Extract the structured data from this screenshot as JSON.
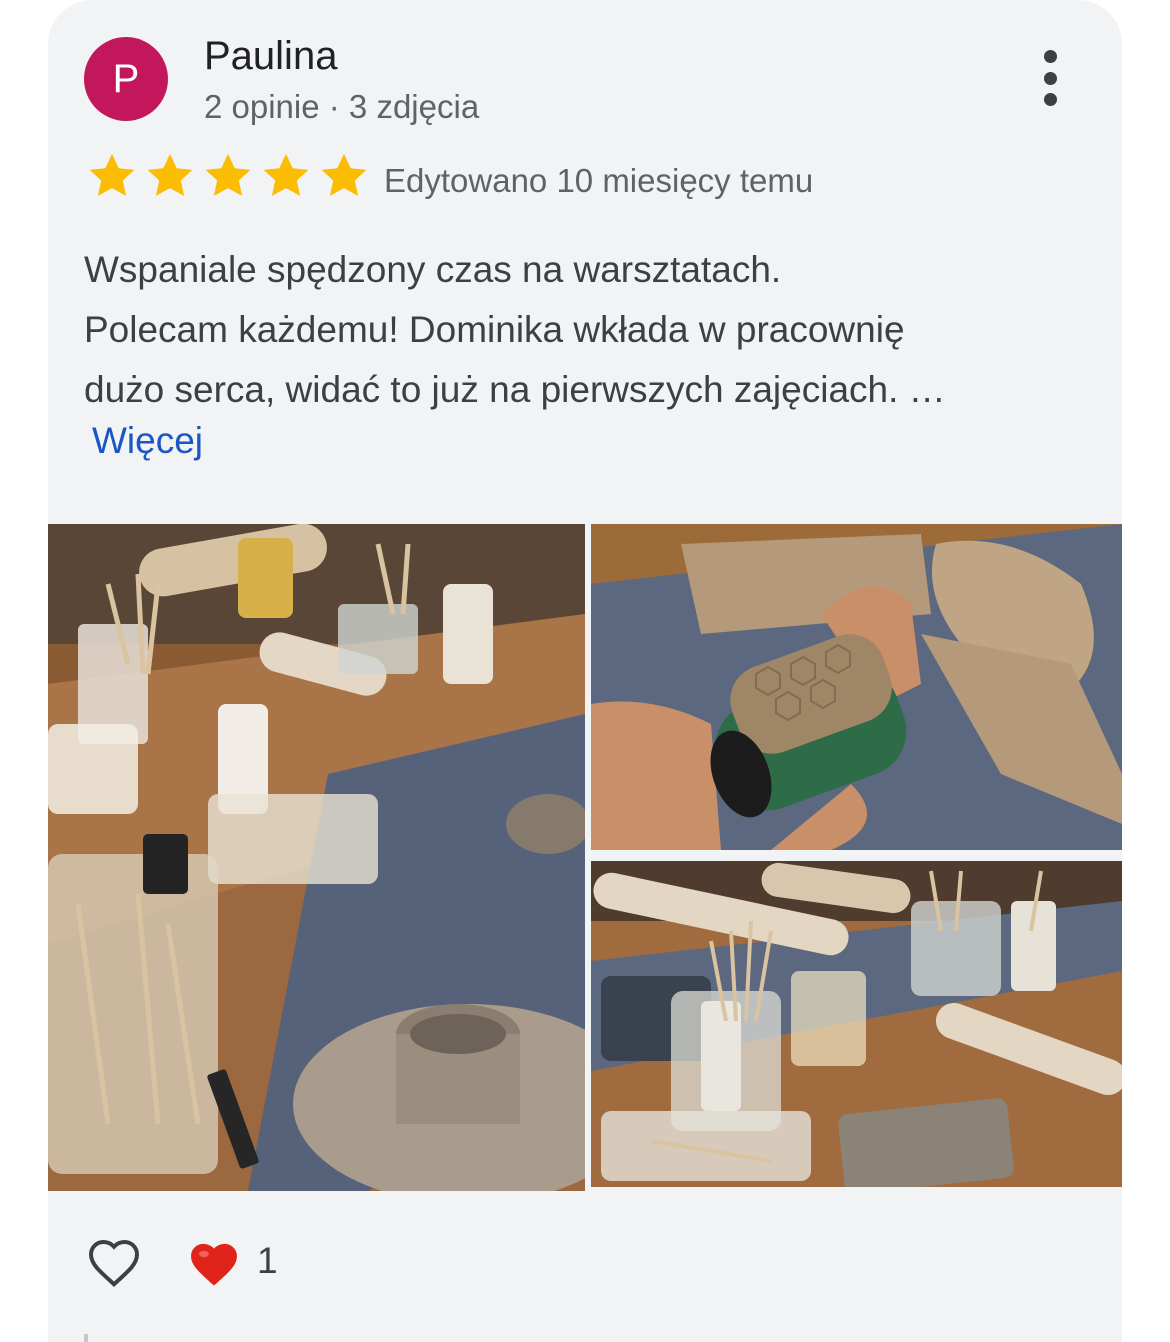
{
  "review": {
    "author": {
      "initial": "P",
      "name": "Paulina",
      "meta": "2 opinie · 3 zdjęcia",
      "avatar_color": "#c2185b"
    },
    "rating": 5,
    "edited": "Edytowano 10 miesięcy temu",
    "text_lines": [
      "Wspaniale spędzony czas na warsztatach.",
      "Polecam każdemu! Dominika wkłada w pracownię",
      "dużo serca, widać to już na pierwszych zajęciach. …"
    ],
    "more_label": "Więcej",
    "likes": "1"
  },
  "icons": {
    "menu": "more-vert-icon",
    "star": "star-icon",
    "like": "heart-outline-icon",
    "reaction": "heart-red-icon"
  },
  "colors": {
    "star": "#fbbc04",
    "link": "#1a56c4",
    "card_bg": "#f2f3f5",
    "heart": "#e0241b"
  }
}
